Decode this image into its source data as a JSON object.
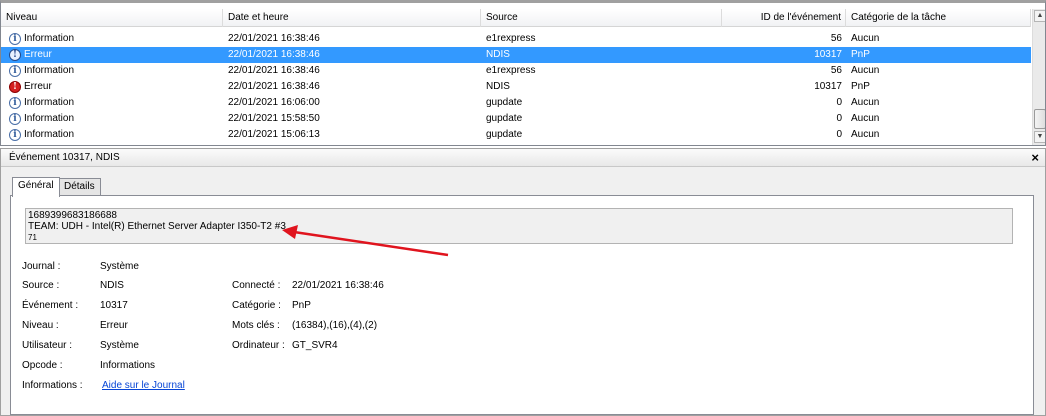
{
  "list": {
    "columns": {
      "level": "Niveau",
      "date": "Date et heure",
      "source": "Source",
      "event_id": "ID de l'événement",
      "task_category": "Catégorie de la tâche"
    },
    "rows": [
      {
        "level": "Information",
        "type": "info",
        "date": "22/01/2021 16:38:46",
        "source": "e1rexpress",
        "event_id": "56",
        "task_category": "Aucun"
      },
      {
        "level": "Erreur",
        "type": "error",
        "date": "22/01/2021 16:38:46",
        "source": "NDIS",
        "event_id": "10317",
        "task_category": "PnP",
        "selected": true
      },
      {
        "level": "Information",
        "type": "info",
        "date": "22/01/2021 16:38:46",
        "source": "e1rexpress",
        "event_id": "56",
        "task_category": "Aucun"
      },
      {
        "level": "Erreur",
        "type": "error",
        "date": "22/01/2021 16:38:46",
        "source": "NDIS",
        "event_id": "10317",
        "task_category": "PnP"
      },
      {
        "level": "Information",
        "type": "info",
        "date": "22/01/2021 16:06:00",
        "source": "gupdate",
        "event_id": "0",
        "task_category": "Aucun"
      },
      {
        "level": "Information",
        "type": "info",
        "date": "22/01/2021 15:58:50",
        "source": "gupdate",
        "event_id": "0",
        "task_category": "Aucun"
      },
      {
        "level": "Information",
        "type": "info",
        "date": "22/01/2021 15:06:13",
        "source": "gupdate",
        "event_id": "0",
        "task_category": "Aucun"
      }
    ]
  },
  "detail": {
    "title": "Événement 10317, NDIS",
    "close": "×",
    "tabs": [
      "Général",
      "Détails"
    ],
    "description": {
      "line1": "1689399683186688",
      "line2": "TEAM: UDH - Intel(R) Ethernet Server Adapter I350-T2 #3",
      "line3": "71"
    },
    "fields": {
      "journal_label": "Journal :",
      "journal_value": "Système",
      "source_label": "Source :",
      "source_value": "NDIS",
      "connecte_label": "Connecté :",
      "connecte_value": "22/01/2021 16:38:46",
      "evenement_label": "Événement :",
      "evenement_value": "10317",
      "categorie_label": "Catégorie :",
      "categorie_value": "PnP",
      "niveau_label": "Niveau :",
      "niveau_value": "Erreur",
      "motscles_label": "Mots clés :",
      "motscles_value": "(16384),(16),(4),(2)",
      "utilisateur_label": "Utilisateur :",
      "utilisateur_value": "Système",
      "ordinateur_label": "Ordinateur :",
      "ordinateur_value": "GT_SVR4",
      "opcode_label": "Opcode :",
      "opcode_value": "Informations",
      "informations_label": "Informations :",
      "informations_link": "Aide sur le Journal"
    }
  },
  "colors": {
    "selection": "#3399ff",
    "annotation_arrow": "#e0141e",
    "link": "#0645d6"
  },
  "icons": {
    "info": "information-icon",
    "error": "error-icon"
  }
}
